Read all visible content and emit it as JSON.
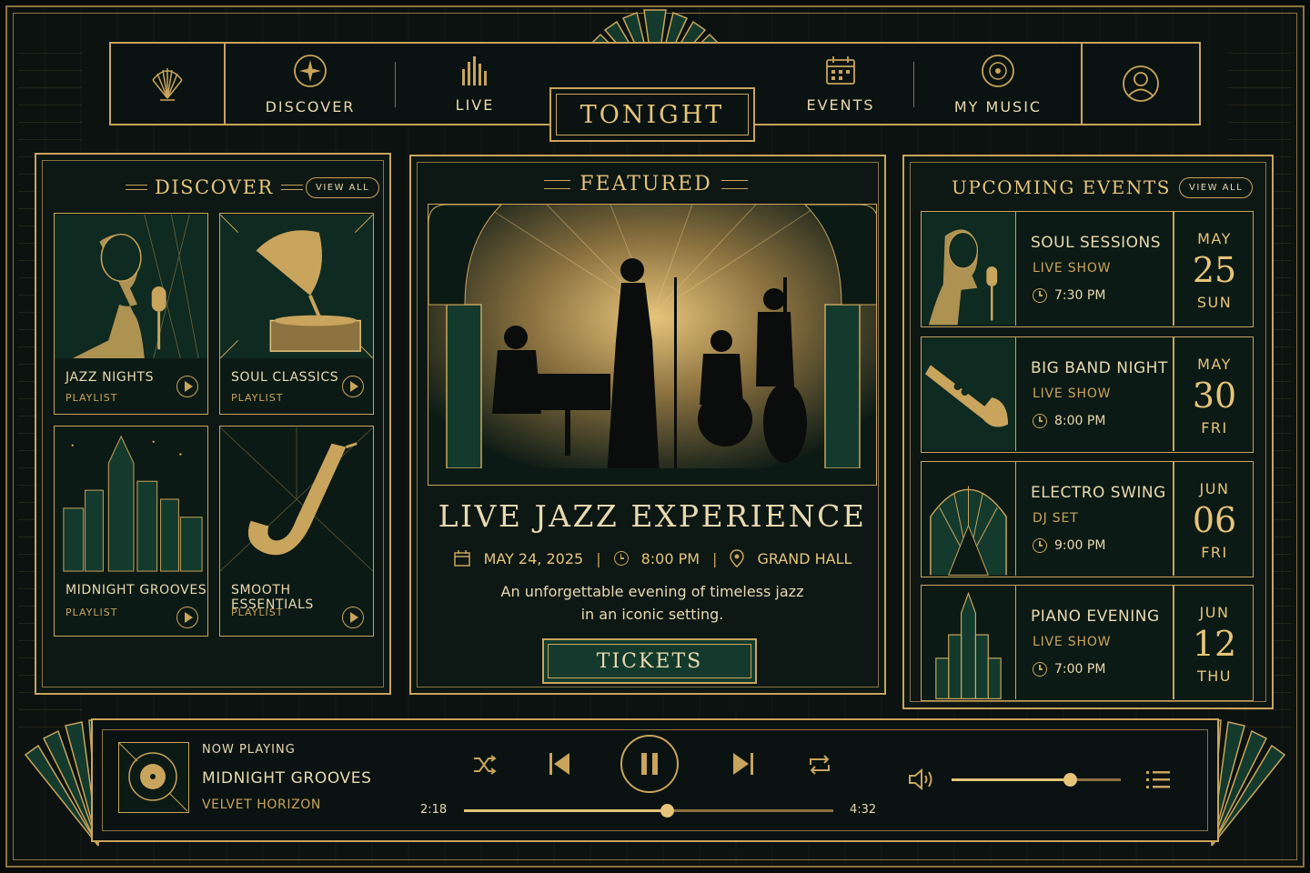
{
  "nav": {
    "items": [
      {
        "label": "DISCOVER",
        "icon": "compass-icon"
      },
      {
        "label": "LIVE",
        "icon": "equalizer-icon"
      },
      {
        "label": "TONIGHT",
        "icon": "",
        "active": true
      },
      {
        "label": "EVENTS",
        "icon": "calendar-icon"
      },
      {
        "label": "MY MUSIC",
        "icon": "vinyl-icon"
      }
    ],
    "logo_icon": "shell-fan-icon",
    "profile_icon": "user-icon"
  },
  "discover": {
    "title": "DISCOVER",
    "view_all": "VIEW ALL",
    "tiles": [
      {
        "title": "JAZZ NIGHTS",
        "sub": "PLAYLIST",
        "art": "singer-microphone"
      },
      {
        "title": "SOUL CLASSICS",
        "sub": "PLAYLIST",
        "art": "gramophone"
      },
      {
        "title": "MIDNIGHT GROOVES",
        "sub": "PLAYLIST",
        "art": "city-skyline"
      },
      {
        "title": "SMOOTH ESSENTIALS",
        "sub": "PLAYLIST",
        "art": "saxophone"
      }
    ]
  },
  "featured": {
    "header": "FEATURED",
    "title": "LIVE JAZZ EXPERIENCE",
    "date": "MAY 24, 2025",
    "time": "8:00 PM",
    "venue": "GRAND HALL",
    "desc_line1": "An unforgettable evening of timeless jazz",
    "desc_line2": "in an iconic setting.",
    "cta": "TICKETS"
  },
  "events": {
    "title": "UPCOMING EVENTS",
    "view_all": "VIEW ALL",
    "items": [
      {
        "title": "SOUL SESSIONS",
        "type": "LIVE SHOW",
        "time": "7:30 PM",
        "month": "MAY",
        "day": "25",
        "dow": "SUN",
        "art": "singer"
      },
      {
        "title": "BIG BAND NIGHT",
        "type": "LIVE SHOW",
        "time": "8:00 PM",
        "month": "MAY",
        "day": "30",
        "dow": "FRI",
        "art": "trumpet"
      },
      {
        "title": "ELECTRO SWING",
        "type": "DJ SET",
        "time": "9:00 PM",
        "month": "JUN",
        "day": "06",
        "dow": "FRI",
        "art": "deco-arch"
      },
      {
        "title": "PIANO EVENING",
        "type": "LIVE SHOW",
        "time": "7:00 PM",
        "month": "JUN",
        "day": "12",
        "dow": "THU",
        "art": "tower"
      }
    ]
  },
  "player": {
    "now_playing_label": "NOW PLAYING",
    "track": "MIDNIGHT GROOVES",
    "artist": "VELVET HORIZON",
    "elapsed": "2:18",
    "duration": "4:32",
    "progress": 0.55,
    "volume": 0.7
  },
  "colors": {
    "gold": "#c9a45c",
    "gold_bright": "#e6c47a",
    "background": "#0b1210",
    "accent_green": "#133a2c"
  }
}
